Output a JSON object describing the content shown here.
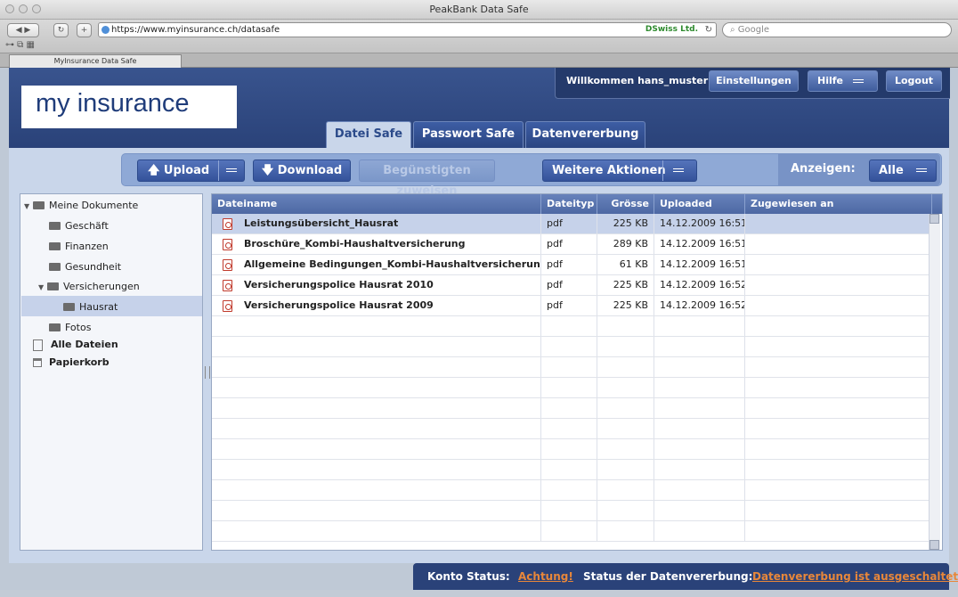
{
  "browser": {
    "window_title": "PeakBank Data Safe",
    "url": "https://www.myinsurance.ch/datasafe",
    "ev_label": "DSwiss Ltd.",
    "search_placeholder": "Google",
    "tab_title": "MyInsurance Data Safe",
    "new_tab": "+",
    "reader_glyph": "⊶ ⧉ ▦"
  },
  "header": {
    "logo_text": "my insurance",
    "welcome": "Willkommen hans_muster",
    "settings": "Einstellungen",
    "help": "Hilfe",
    "logout": "Logout",
    "tabs": [
      {
        "label": "Datei Safe",
        "active": true
      },
      {
        "label": "Passwort Safe",
        "active": false
      },
      {
        "label": "Datenvererbung",
        "active": false
      }
    ]
  },
  "actions": {
    "upload": "Upload",
    "download": "Download",
    "assign": "Begünstigten zuweisen",
    "more": "Weitere Aktionen",
    "show_label": "Anzeigen:",
    "show_value": "Alle"
  },
  "sidebar": {
    "root": "Meine Dokumente",
    "items": [
      {
        "label": "Geschäft"
      },
      {
        "label": "Finanzen"
      },
      {
        "label": "Gesundheit"
      },
      {
        "label": "Versicherungen"
      },
      {
        "label": "Hausrat",
        "selected": true
      },
      {
        "label": "Fotos"
      }
    ],
    "all_files": "Alle Dateien",
    "trash": "Papierkorb"
  },
  "table": {
    "columns": [
      "Dateiname",
      "Dateityp",
      "Grösse",
      "Uploaded",
      "Zugewiesen an"
    ],
    "rows": [
      {
        "name": "Leistungsübersicht_Hausrat",
        "type": "pdf",
        "size": "225 KB",
        "uploaded": "14.12.2009 16:51",
        "assigned": "",
        "selected": true
      },
      {
        "name": "Broschüre_Kombi-Haushaltversicherung",
        "type": "pdf",
        "size": "289 KB",
        "uploaded": "14.12.2009 16:51",
        "assigned": ""
      },
      {
        "name": "Allgemeine Bedingungen_Kombi-Haushaltversicherung",
        "type": "pdf",
        "size": "61 KB",
        "uploaded": "14.12.2009 16:51",
        "assigned": ""
      },
      {
        "name": "Versicherungspolice Hausrat 2010",
        "type": "pdf",
        "size": "225 KB",
        "uploaded": "14.12.2009 16:52",
        "assigned": ""
      },
      {
        "name": "Versicherungspolice Hausrat 2009",
        "type": "pdf",
        "size": "225 KB",
        "uploaded": "14.12.2009 16:52",
        "assigned": ""
      }
    ],
    "empty_rows": 11
  },
  "status": {
    "account_label": "Konto Status:",
    "account_value": "Achtung!",
    "inherit_label": "Status der Datenvererbung:",
    "inherit_value": "Datenvererbung ist ausgeschaltet"
  },
  "colors": {
    "brand_blue": "#2a4279",
    "link_orange": "#e8873a"
  }
}
